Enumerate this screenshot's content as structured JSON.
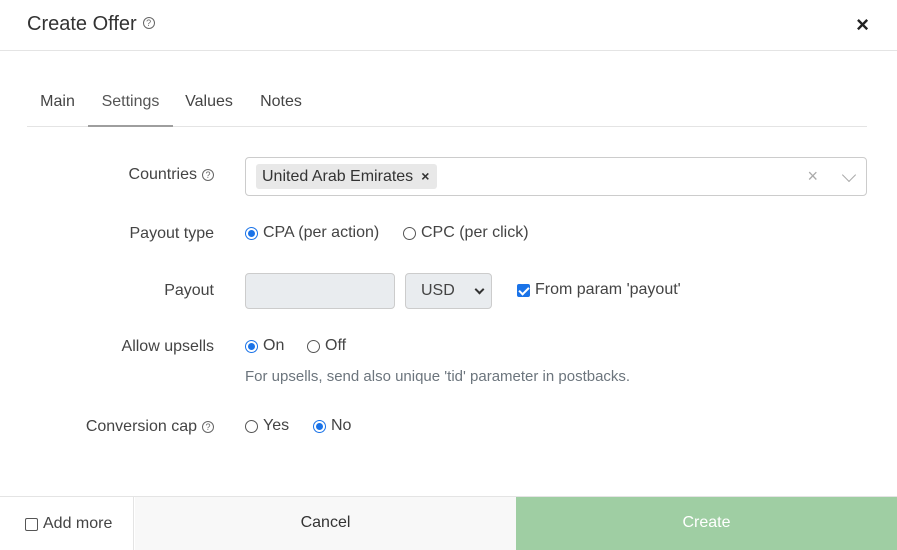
{
  "header": {
    "title": "Create Offer",
    "help_icon": "?",
    "close_icon": "×"
  },
  "tabs": [
    {
      "label": "Main"
    },
    {
      "label": "Settings",
      "active": true
    },
    {
      "label": "Values"
    },
    {
      "label": "Notes"
    }
  ],
  "countries": {
    "label": "Countries",
    "help_icon": "?",
    "selected": [
      "United Arab Emirates"
    ],
    "tag_remove": "×",
    "clear": "×"
  },
  "payout_type": {
    "label": "Payout type",
    "options": [
      {
        "label": "CPA (per action)",
        "checked": true
      },
      {
        "label": "CPC (per click)",
        "checked": false
      }
    ]
  },
  "payout": {
    "label": "Payout",
    "value": "",
    "currency": "USD",
    "from_param_label": "From param 'payout'",
    "from_param_checked": true
  },
  "allow_upsells": {
    "label": "Allow upsells",
    "options": [
      {
        "label": "On",
        "checked": true
      },
      {
        "label": "Off",
        "checked": false
      }
    ],
    "hint": "For upsells, send also unique 'tid' parameter in postbacks."
  },
  "conversion_cap": {
    "label": "Conversion cap",
    "help_icon": "?",
    "options": [
      {
        "label": "Yes",
        "checked": false
      },
      {
        "label": "No",
        "checked": true
      }
    ]
  },
  "footer": {
    "add_more_label": "Add more",
    "add_more_checked": false,
    "cancel_label": "Cancel",
    "create_label": "Create"
  },
  "colors": {
    "accent": "#1a73e8",
    "create_button": "#9fcea3",
    "disabled_input": "#e9ecef"
  }
}
